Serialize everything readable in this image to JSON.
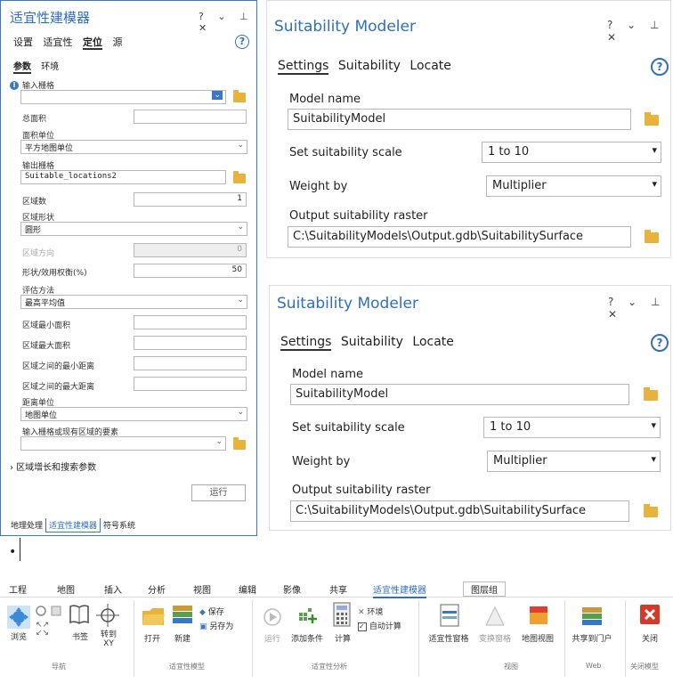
{
  "cn_pane": {
    "title": "适宜性建模器",
    "title_controls": "? ⌄ ⊥ ✕",
    "tabs": [
      "设置",
      "适宜性",
      "定位",
      "源"
    ],
    "subtabs": [
      "参数",
      "环境"
    ],
    "fields": {
      "input_raster_label": "输入栅格",
      "total_area_label": "总面积",
      "area_unit_label": "面积单位",
      "area_unit_value": "平方地图单位",
      "output_raster_label": "输出栅格",
      "output_raster_value": "Suitable_locations2",
      "region_count_label": "区域数",
      "region_count_value": "1",
      "region_shape_label": "区域形状",
      "region_shape_value": "圆形",
      "region_direction_label": "区域方向",
      "region_direction_value": "0",
      "shape_weight_label": "形状/效用权衡(%)",
      "shape_weight_value": "50",
      "eval_method_label": "评估方法",
      "eval_method_value": "最高平均值",
      "min_area_label": "区域最小面积",
      "max_area_label": "区域最大面积",
      "min_dist_label": "区域之间的最小距离",
      "max_dist_label": "区域之间的最大距离",
      "dist_unit_label": "距离单位",
      "dist_unit_value": "地图单位",
      "input_features_label": "输入栅格或现有区域的要素",
      "growth_params": "区域增长和搜索参数",
      "run_button": "运行"
    },
    "bottom_tabs": [
      "地理处理",
      "适宜性建模器",
      "符号系统"
    ]
  },
  "en_pane_top": {
    "title": "Suitability Modeler",
    "title_controls": "? ⌄ ⊥ ✕",
    "tabs": [
      "Settings",
      "Suitability",
      "Locate"
    ],
    "model_name_label": "Model name",
    "model_name_value": "SuitabilityModel",
    "scale_label": "Set suitability scale",
    "scale_value": "1 to 10",
    "weight_label": "Weight by",
    "weight_value": "Multiplier",
    "output_label": "Output suitability raster",
    "output_value": "C:\\SuitabilityModels\\Output.gdb\\SuitabilitySurface"
  },
  "en_pane_bottom": {
    "title": "Suitability Modeler",
    "title_controls": "? ⌄ ⊥ ✕",
    "tabs": [
      "Settings",
      "Suitability",
      "Locate"
    ],
    "model_name_label": "Model name",
    "model_name_value": "SuitabilityModel",
    "scale_label": "Set suitability scale",
    "scale_value": "1 to 10",
    "weight_label": "Weight by",
    "weight_value": "Multiplier",
    "output_label": "Output suitability raster",
    "output_value": "C:\\SuitabilityModels\\Output.gdb\\SuitabilitySurface"
  },
  "bullet": "•",
  "ribbon": {
    "menu": [
      "工程",
      "地图",
      "插入",
      "分析",
      "视图",
      "编辑",
      "影像",
      "共享",
      "适宜性建模器",
      "图层组"
    ],
    "tools": {
      "browse": "浏览",
      "bookmark": "书签",
      "goto": "转到\nXY",
      "open": "打开",
      "new": "新建",
      "save": "保存",
      "saveas": "另存为",
      "run": "运行",
      "add_criteria": "添加条件",
      "calculate": "计算",
      "env": "环境",
      "auto_calc": "自动计算",
      "suit_pane": "适宜性窗格",
      "transform_pane": "变换窗格",
      "map_view": "地图视图",
      "share_portal": "共享到门户",
      "close": "关闭"
    },
    "groups": {
      "nav": "导航",
      "model": "适宜性模型",
      "analysis": "适宜性分析",
      "view": "视图",
      "web": "Web",
      "close_model": "关闭模型"
    }
  }
}
